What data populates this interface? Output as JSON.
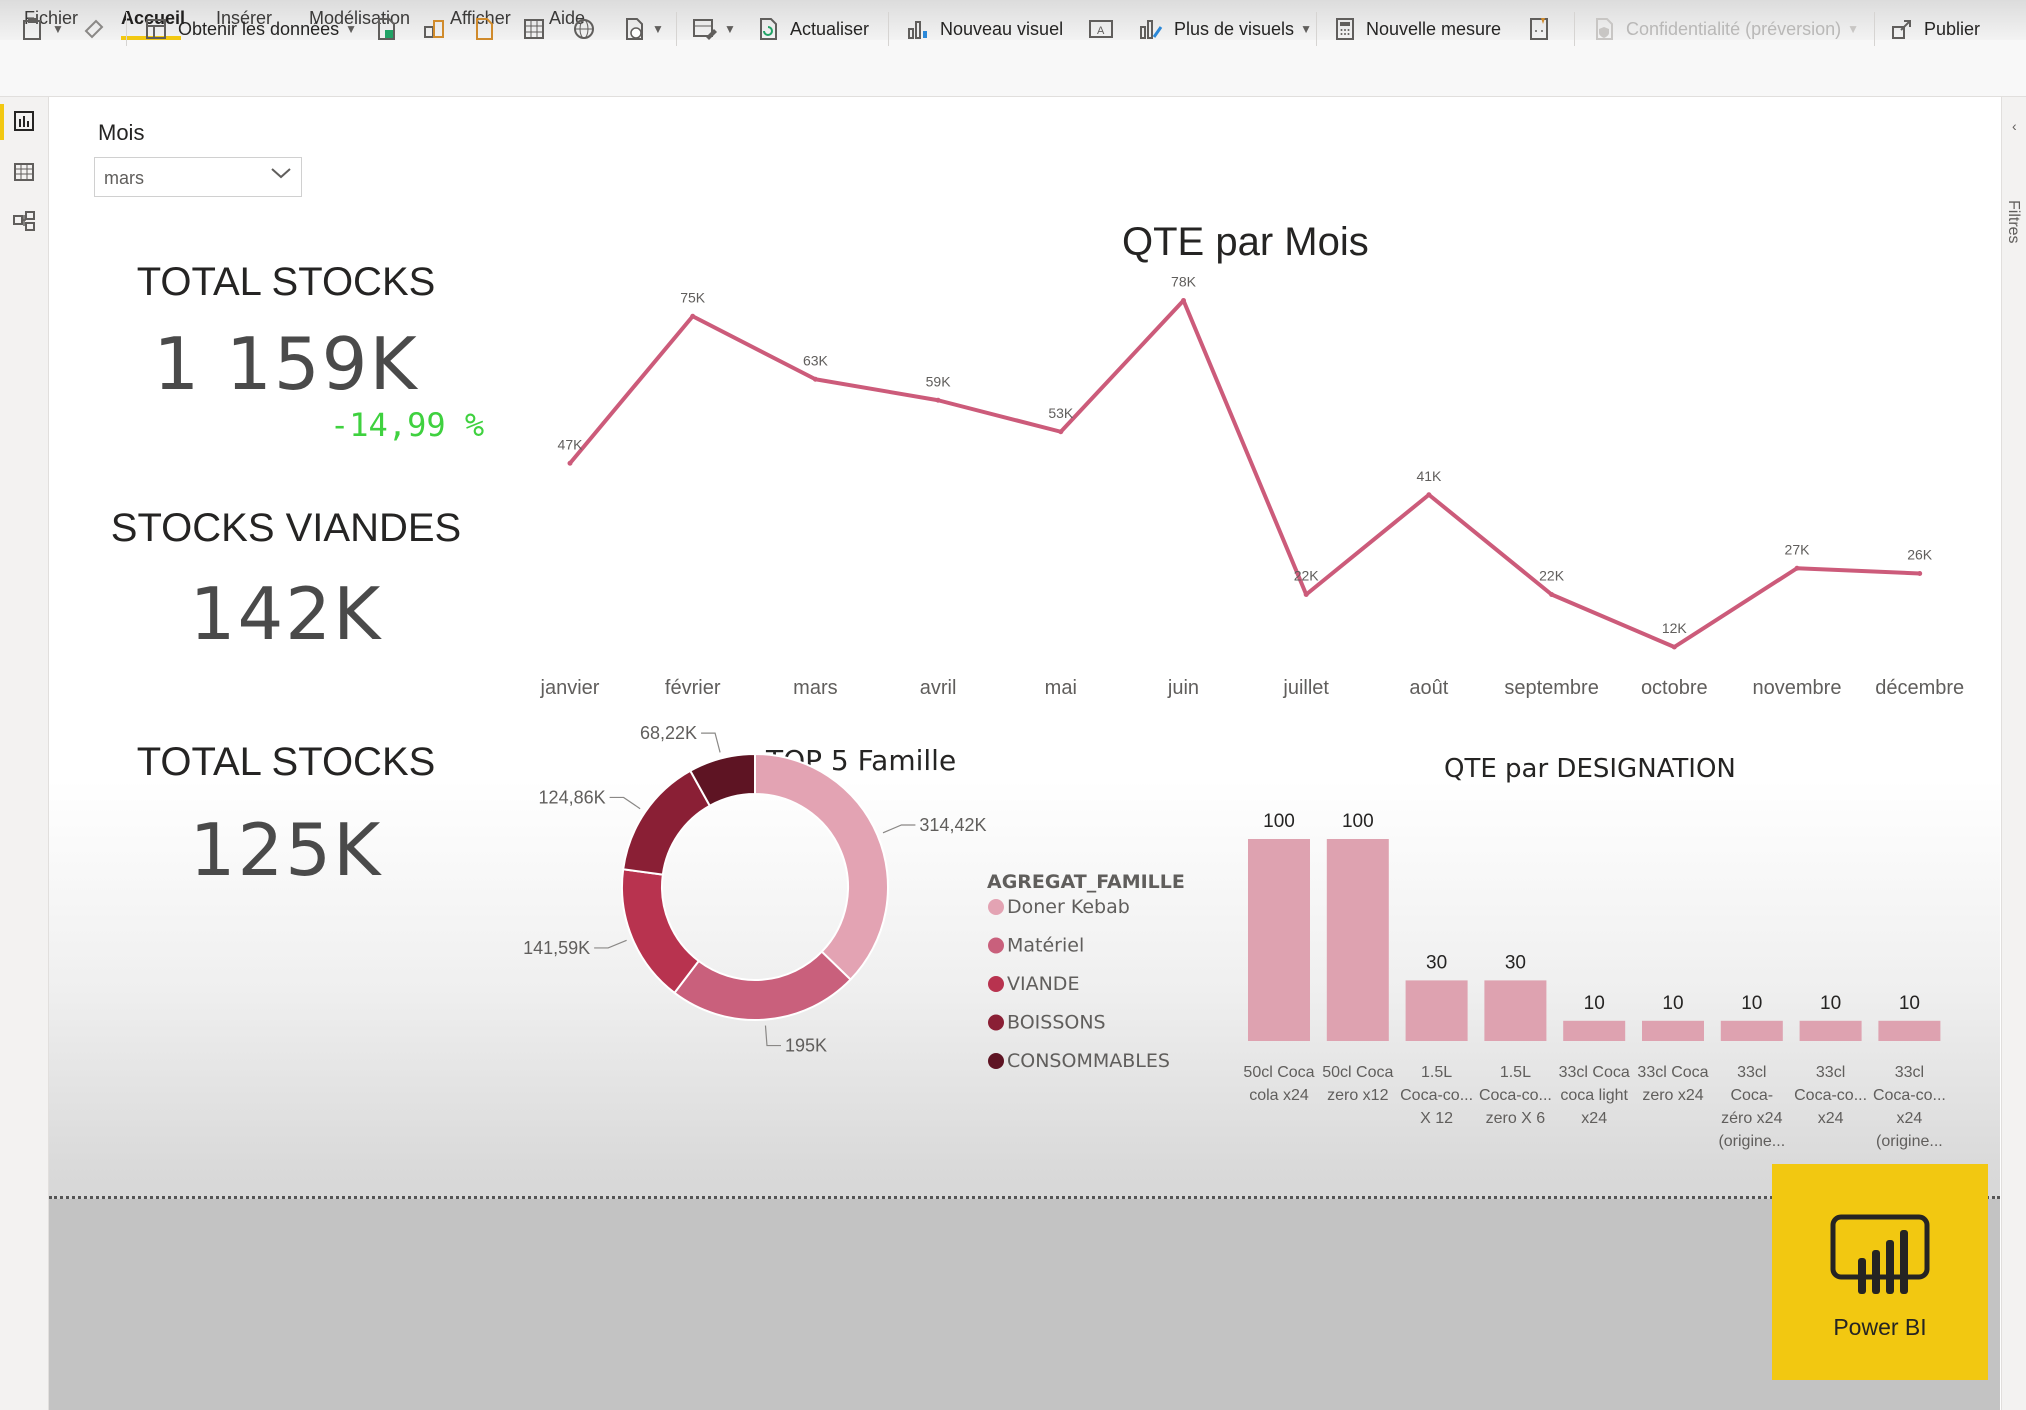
{
  "menu": {
    "items": [
      "Fichier",
      "Accueil",
      "Insérer",
      "Modélisation",
      "Afficher",
      "Aide"
    ],
    "active": "Accueil"
  },
  "ribbon": {
    "get_data": "Obtenir les données",
    "refresh": "Actualiser",
    "new_visual": "Nouveau visuel",
    "more_visuals": "Plus de visuels",
    "new_measure": "Nouvelle mesure",
    "sensitivity": "Confidentialité (préversion)",
    "publish": "Publier"
  },
  "right_pane": {
    "filters_label": "Filtres"
  },
  "slicer": {
    "title": "Mois",
    "value": "mars"
  },
  "kpis": {
    "total_stocks_1": {
      "title": "TOTAL STOCKS",
      "value": "1 159K",
      "delta": "-14,99 %"
    },
    "stocks_viandes": {
      "title": "STOCKS VIANDES",
      "value": "142K"
    },
    "total_stocks_2": {
      "title": "TOTAL STOCKS",
      "value": "125K"
    }
  },
  "colors": {
    "line": "#cc5b7a",
    "accent_yellow": "#f2c811",
    "delta_green": "#3fd13f",
    "donut": [
      "#e3a3b3",
      "#c9607c",
      "#b8334f",
      "#8a1f35",
      "#5e1423"
    ],
    "bar": "#dea2b0"
  },
  "chart_data": [
    {
      "type": "line",
      "title": "QTE par Mois",
      "categories": [
        "janvier",
        "février",
        "mars",
        "avril",
        "mai",
        "juin",
        "juillet",
        "août",
        "septembre",
        "octobre",
        "novembre",
        "décembre"
      ],
      "values": [
        47,
        75,
        63,
        59,
        53,
        78,
        22,
        41,
        22,
        12,
        27,
        26
      ],
      "labels": [
        "47K",
        "75K",
        "63K",
        "59K",
        "53K",
        "78K",
        "22K",
        "41K",
        "22K",
        "12K",
        "27K",
        "26K"
      ],
      "ylim": [
        0,
        80
      ]
    },
    {
      "type": "pie",
      "title": "TOP 5 Famille",
      "legend_title": "AGREGAT_FAMILLE",
      "categories": [
        "Doner Kebab",
        "Matériel",
        "VIANDE",
        "BOISSONS",
        "CONSOMMABLES"
      ],
      "values": [
        314.42,
        195,
        141.59,
        124.86,
        68.22
      ],
      "labels": [
        "314,42K",
        "195K",
        "141,59K",
        "124,86K",
        "68,22K"
      ]
    },
    {
      "type": "bar",
      "title": "QTE par DESIGNATION",
      "categories": [
        [
          "50cl Coca",
          "cola x24"
        ],
        [
          "50cl Coca",
          "zero x12"
        ],
        [
          "1.5L",
          "Coca-co...",
          "X 12"
        ],
        [
          "1.5L",
          "Coca-co...",
          "zero X 6"
        ],
        [
          "33cl Coca",
          "coca light",
          "x24"
        ],
        [
          "33cl Coca",
          "zero x24"
        ],
        [
          "33cl",
          "Coca-",
          "zéro x24",
          "(origine..."
        ],
        [
          "33cl",
          "Coca-co...",
          "x24"
        ],
        [
          "33cl",
          "Coca-co...",
          "x24",
          "(origine..."
        ]
      ],
      "values": [
        100,
        100,
        30,
        30,
        10,
        10,
        10,
        10,
        10
      ],
      "ylim": [
        0,
        100
      ]
    }
  ],
  "logo": {
    "text": "Power BI"
  }
}
